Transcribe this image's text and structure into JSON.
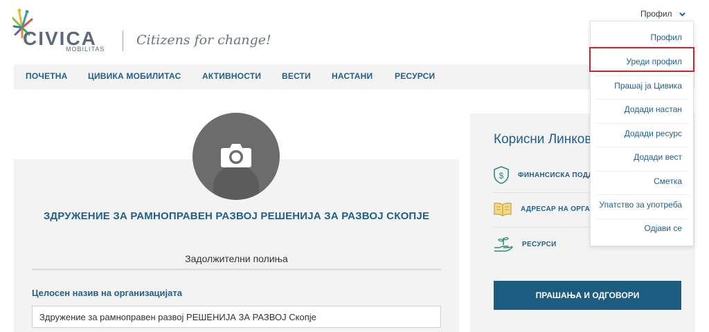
{
  "header": {
    "brand": "CIVICA",
    "brand_sub": "MOBILITAS",
    "tagline": "Citizens for change!",
    "profile_label": "Профил"
  },
  "nav": {
    "items": [
      "ПОЧЕТНА",
      "ЦИВИКА МОБИЛИТАС",
      "АКТИВНОСТИ",
      "ВЕСТИ",
      "НАСТАНИ",
      "РЕСУРСИ"
    ]
  },
  "main": {
    "org_title": "ЗДРУЖЕНИЕ ЗА РАМНОПРАВЕН РАЗВОЈ РЕШЕНИЈА ЗА РАЗВОЈ СКОПЈЕ",
    "required_fields_label": "Задолжителни полиња",
    "full_name_label": "Целосен назив на организацијата",
    "full_name_value": "Здружение за рамноправен развој РЕШЕНИЈА ЗА РАЗВОЈ Скопје"
  },
  "side": {
    "title": "Корисни Линков",
    "links": [
      {
        "label": "ФИНАНСИСКА ПОДД",
        "icon": "dollar-shield-icon"
      },
      {
        "label": "АДРЕСАР НА ОРГАНИ",
        "icon": "open-book-icon"
      },
      {
        "label": "РЕСУРСИ",
        "icon": "hand-plant-icon"
      }
    ],
    "qa_button": "ПРАШАЊА И ОДГОВОРИ"
  },
  "dropdown": {
    "items": [
      "Профил",
      "Уреди профил",
      "Прашај ја Цивика",
      "Додади настан",
      "Додади ресурс",
      "Додади вест",
      "Сметка",
      "Упатство за употреба",
      "Одјави се"
    ],
    "highlighted": "Уреди профил"
  },
  "colors": {
    "accent_blue": "#1f5f8a",
    "button_blue": "#1b5c80",
    "highlight_red": "#d0232a",
    "panel_gray": "#f3f3f3"
  }
}
